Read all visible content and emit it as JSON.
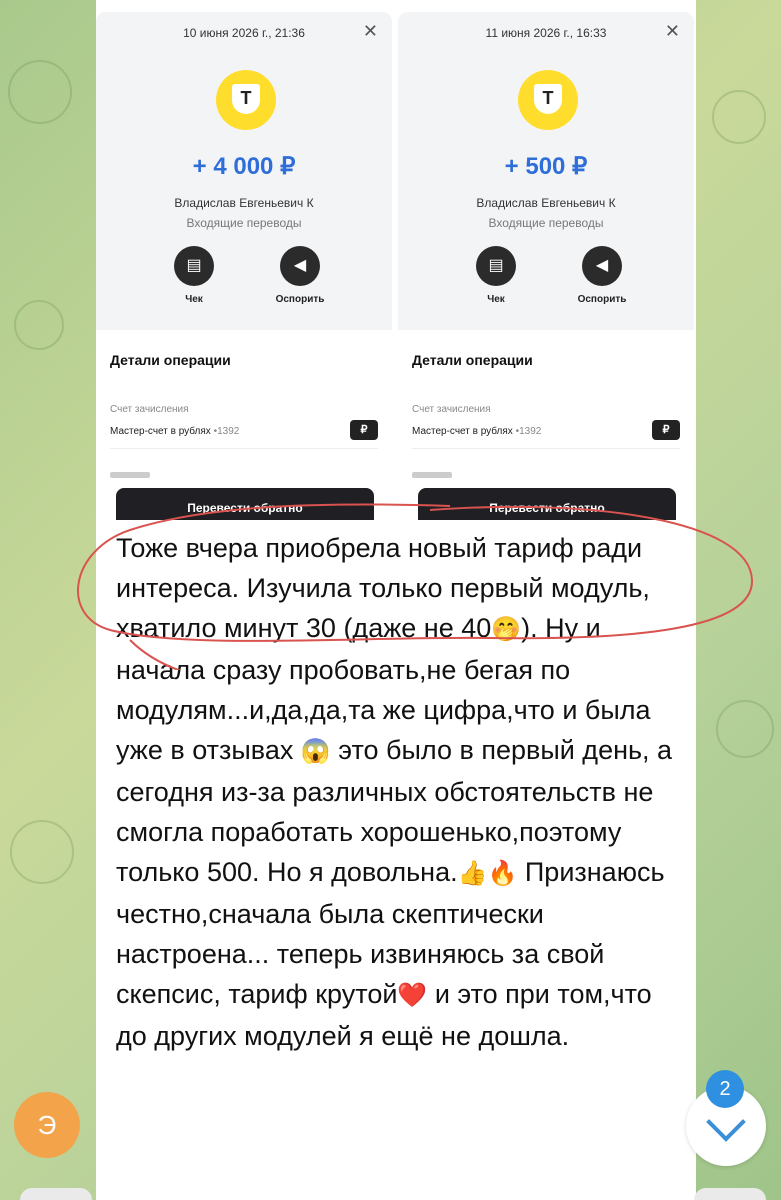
{
  "receipts": [
    {
      "date": "10 июня 2026 г., 21:36",
      "logo_letter": "Т",
      "amount": "+ 4 000 ₽",
      "sender": "Владислав Евгеньевич К",
      "category": "Входящие переводы",
      "actions": [
        {
          "label": "Чек",
          "icon": "receipt-icon"
        },
        {
          "label": "Оспорить",
          "icon": "megaphone-icon"
        }
      ],
      "details_title": "Детали операции",
      "account_label": "Счет зачисления",
      "account_value": "Мастер-счет в рублях",
      "account_mask": "•1392",
      "currency_badge": "₽",
      "button": "Перевести обратно"
    },
    {
      "date": "11 июня 2026 г., 16:33",
      "logo_letter": "Т",
      "amount": "+ 500 ₽",
      "sender": "Владислав Евгеньевич К",
      "category": "Входящие переводы",
      "actions": [
        {
          "label": "Чек",
          "icon": "receipt-icon"
        },
        {
          "label": "Оспорить",
          "icon": "megaphone-icon"
        }
      ],
      "details_title": "Детали операции",
      "account_label": "Счет зачисления",
      "account_value": "Мастер-счет в рублях",
      "account_mask": "•1392",
      "currency_badge": "₽",
      "button": "Перевести обратно"
    }
  ],
  "message": {
    "p1": "Тоже вчера приобрела новый тариф ради интереса. Изучила только первый модуль, хватило минут 30 (даже не 40",
    "e1": "🤭",
    "p2": "). Ну и начала сразу пробовать,не бегая по модулям...и,да,да,та же цифра,что и была уже в отзывах ",
    "e2": "😱",
    "p3": "  это было в первый день, а сегодня из-за различных обстоятельств не смогла поработать хорошенько,поэтому только 500. Но я довольна.",
    "e3": "👍🔥",
    "p4": " Признаюсь честно,сначала была скептически настроена... теперь извиняюсь за свой скепсис, тариф крутой",
    "e4": "❤️",
    "p5": " и это при том,что до других модулей я ещё не дошла."
  },
  "avatar_letter": "Э",
  "unread_count": "2",
  "colors": {
    "accent": "#2f8fe0",
    "amount": "#2f6ed8",
    "logo": "#ffdd2d",
    "annotation": "#d9534f"
  }
}
